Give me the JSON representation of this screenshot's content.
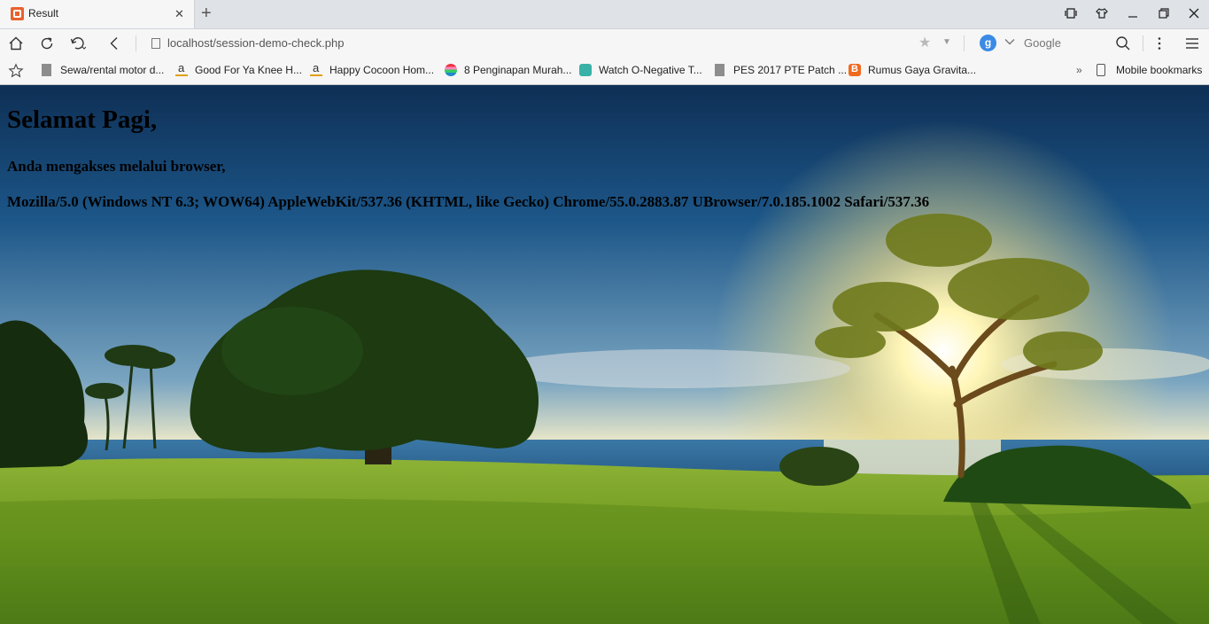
{
  "browser": {
    "tab": {
      "title": "Result"
    },
    "address": {
      "url": "localhost/session-demo-check.php"
    },
    "search": {
      "engine_letter": "g",
      "placeholder": "Google"
    },
    "bookmarks": [
      {
        "label": "Sewa/rental motor d...",
        "icon": "document-icon"
      },
      {
        "label": "Good For Ya Knee H...",
        "icon": "amazon-icon"
      },
      {
        "label": "Happy Cocoon Hom...",
        "icon": "amazon-icon"
      },
      {
        "label": "8 Penginapan Murah...",
        "icon": "site-icon"
      },
      {
        "label": "Watch O-Negative T...",
        "icon": "watch-site-icon"
      },
      {
        "label": "PES 2017 PTE Patch ...",
        "icon": "document-icon"
      },
      {
        "label": "Rumus Gaya Gravita...",
        "icon": "blogger-icon"
      }
    ],
    "overflow_label": "»",
    "mobile_bookmarks": "Mobile bookmarks"
  },
  "page": {
    "greeting": "Selamat Pagi,",
    "browser_line": "Anda mengakses melalui browser,",
    "user_agent": "Mozilla/5.0 (Windows NT 6.3; WOW64) AppleWebKit/537.36 (KHTML, like Gecko) Chrome/55.0.2883.87 UBrowser/7.0.185.1002 Safari/537.36"
  },
  "colors": {
    "brand_orange": "#e8622e",
    "search_engine_blue": "#3b8ae6"
  }
}
